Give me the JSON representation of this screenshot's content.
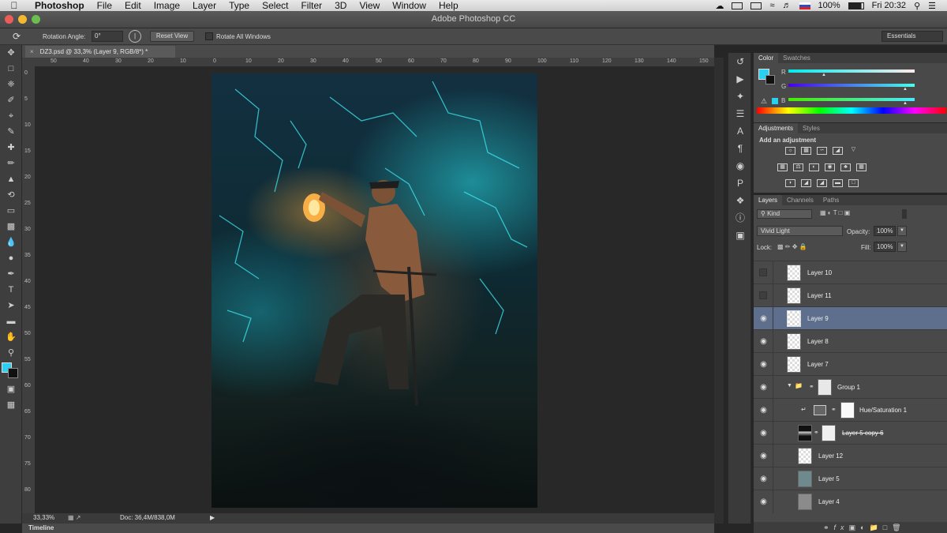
{
  "menubar": {
    "apple": "",
    "items": [
      "Photoshop",
      "File",
      "Edit",
      "Image",
      "Layer",
      "Type",
      "Select",
      "Filter",
      "3D",
      "View",
      "Window",
      "Help"
    ],
    "battery": "100%",
    "clock": "Fri 20:32"
  },
  "window": {
    "title": "Adobe Photoshop CC"
  },
  "options": {
    "rotation_label": "Rotation Angle:",
    "rotation_value": "0°",
    "reset_label": "Reset View",
    "rotate_all_label": "Rotate All Windows",
    "workspace": "Essentials"
  },
  "document": {
    "tab_label": "DZ3.psd @ 33,3% (Layer 9, RGB/8*) *",
    "ruler_h": [
      "50",
      "40",
      "30",
      "20",
      "10",
      "0",
      "10",
      "20",
      "30",
      "40",
      "50",
      "60",
      "70",
      "80",
      "90",
      "100",
      "110",
      "120",
      "130",
      "140",
      "150"
    ],
    "ruler_v": [
      "0",
      "5",
      "10",
      "15",
      "20",
      "25",
      "30",
      "35",
      "40",
      "45",
      "50",
      "55",
      "60",
      "65",
      "70",
      "75",
      "80"
    ]
  },
  "status": {
    "zoom": "33,33%",
    "doc_size": "Doc: 36,4M/838,0M"
  },
  "timeline": {
    "label": "Timeline"
  },
  "color_panel": {
    "tabs": [
      "Color",
      "Swatches"
    ],
    "r_label": "R",
    "g_label": "G",
    "b_label": "B",
    "r": "73",
    "g": "234",
    "b": "235",
    "fg_color": "#2bd0f0"
  },
  "adjustments_panel": {
    "tabs": [
      "Adjustments",
      "Styles"
    ],
    "heading": "Add an adjustment"
  },
  "layers_panel": {
    "tabs": [
      "Layers",
      "Channels",
      "Paths"
    ],
    "filter": "Kind",
    "blend_mode": "Vivid Light",
    "opacity_label": "Opacity:",
    "opacity": "100%",
    "lock_label": "Lock:",
    "fill_label": "Fill:",
    "fill": "100%",
    "layers": [
      {
        "name": "Layer 10",
        "visible": false,
        "selected": false
      },
      {
        "name": "Layer 11",
        "visible": false,
        "selected": false
      },
      {
        "name": "Layer 9",
        "visible": true,
        "selected": true
      },
      {
        "name": "Layer 8",
        "visible": true,
        "selected": false
      },
      {
        "name": "Layer 7",
        "visible": true,
        "selected": false
      },
      {
        "name": "Group 1",
        "visible": true,
        "selected": false
      },
      {
        "name": "Hue/Saturation 1",
        "visible": true,
        "selected": false
      },
      {
        "name": "Layer 5 copy 6",
        "visible": true,
        "selected": false
      },
      {
        "name": "Layer 12",
        "visible": true,
        "selected": false
      },
      {
        "name": "Layer 5",
        "visible": true,
        "selected": false
      },
      {
        "name": "Layer 4",
        "visible": true,
        "selected": false
      }
    ]
  }
}
